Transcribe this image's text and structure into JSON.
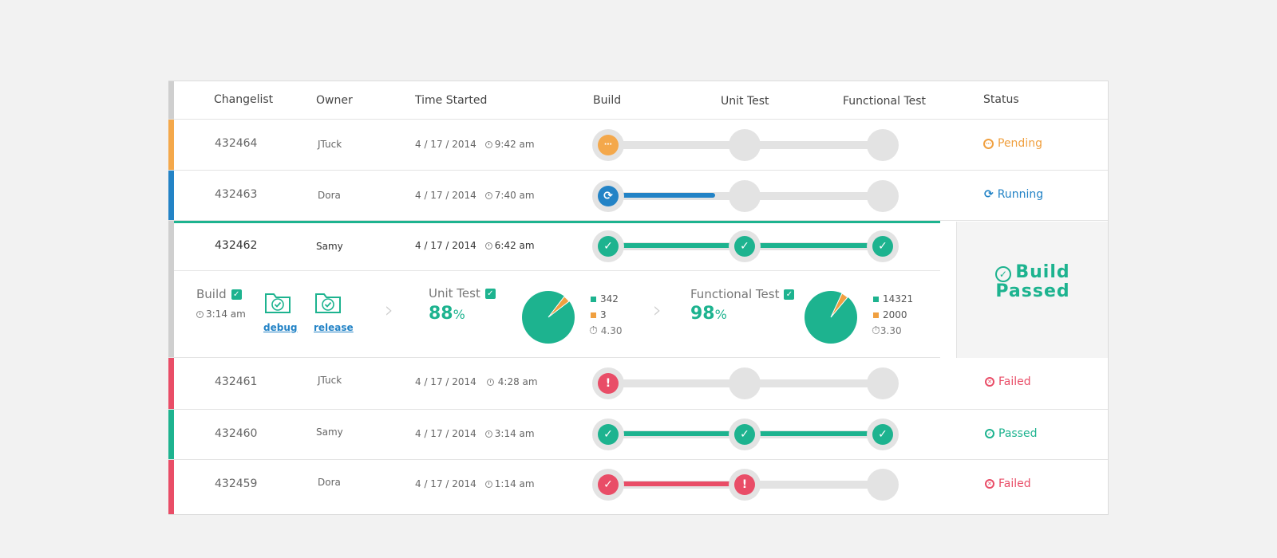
{
  "headers": {
    "changelist": "Changelist",
    "owner": "Owner",
    "time_started": "Time Started",
    "build": "Build",
    "unit_test": "Unit Test",
    "functional_test": "Functional Test",
    "status": "Status"
  },
  "rows": [
    {
      "changelist": "432464",
      "owner": "JTuck",
      "date": "4 / 17 / 2014",
      "time": "9:42 am",
      "status": "Pending"
    },
    {
      "changelist": "432463",
      "owner": "Dora",
      "date": "4 / 17 / 2014",
      "time": "7:40 am",
      "status": "Running"
    },
    {
      "changelist": "432462",
      "owner": "Samy",
      "date": "4 / 17 / 2014",
      "time": "6:42 am",
      "status": "Build Passed"
    },
    {
      "changelist": "432461",
      "owner": "JTuck",
      "date": "4 / 17 / 2014",
      "time": "4:28 am",
      "status": "Failed"
    },
    {
      "changelist": "432460",
      "owner": "Samy",
      "date": "4 / 17 / 2014",
      "time": "3:14 am",
      "status": "Passed"
    },
    {
      "changelist": "432459",
      "owner": "Dora",
      "date": "4 / 17 / 2014",
      "time": "1:14 am",
      "status": "Failed"
    }
  ],
  "expanded": {
    "build_label": "Build",
    "build_time": "3:14 am",
    "debug": "debug",
    "release": "release",
    "unit_test_label": "Unit Test",
    "unit_test_pct": "88",
    "unit_pass": "342",
    "unit_fail": "3",
    "unit_time": "4.30",
    "functional_label": "Functional Test",
    "functional_pct": "98",
    "func_pass": "14321",
    "func_fail": "2000",
    "func_time": "3.30",
    "big_status_line1": "Build",
    "big_status_line2": "Passed"
  },
  "pct_sign": "%",
  "colors": {
    "teal": "#1db38f",
    "red": "#e94d67",
    "orange": "#f0a040",
    "blue": "#2383c6",
    "gray": "#cfcfcf"
  }
}
